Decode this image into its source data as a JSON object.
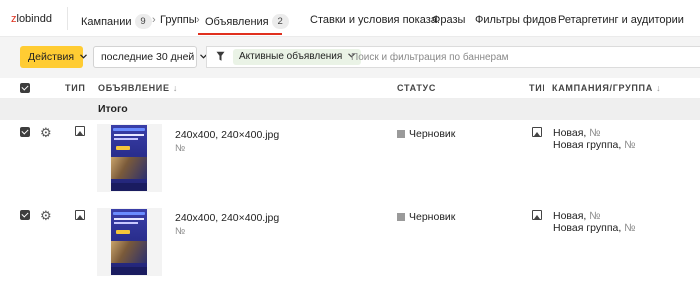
{
  "app": {
    "logo_prefix": "z",
    "logo_rest": "lobindd"
  },
  "nav": {
    "campaigns": {
      "label": "Кампании",
      "count": "9"
    },
    "groups": {
      "label": "Группы"
    },
    "ads": {
      "label": "Объявления",
      "count": "2"
    },
    "separator": "›",
    "links": [
      "Ставки и условия показа:",
      "Фразы",
      "Фильтры фидов",
      "Ретаргетинг и аудитории"
    ]
  },
  "filters": {
    "actions_label": "Действия",
    "period_label": "последние 30 дней",
    "chip_label": "Активные объявления",
    "search_placeholder": "Поиск и фильтрация по баннерам"
  },
  "table": {
    "headers": {
      "type": "ТИП",
      "ad": "ОБЪЯВЛЕНИЕ",
      "status": "СТАТУС",
      "type2": "ТИП",
      "campaign": "КАМПАНИЯ/ГРУППА"
    },
    "sort_glyph": "↓",
    "total_label": "Итого",
    "rows": [
      {
        "name": "240x400, 240×400.jpg",
        "number": "№",
        "status": "Черновик",
        "campaign": "Новая,",
        "campaign_no": "№",
        "group": "Новая группа,",
        "group_no": "№"
      },
      {
        "name": "240x400, 240×400.jpg",
        "number": "№",
        "status": "Черновик",
        "campaign": "Новая,",
        "campaign_no": "№",
        "group": "Новая группа,",
        "group_no": "№"
      }
    ]
  },
  "colors": {
    "accent_yellow": "#ffcc33",
    "active_tab_underline": "#e0301e",
    "chip_bg": "#eaf3e6",
    "status_draft": "#9a9a9a"
  },
  "icons": {
    "settings": "gear-icon",
    "ad_type": "image-ad-icon",
    "filter": "funnel-icon"
  }
}
